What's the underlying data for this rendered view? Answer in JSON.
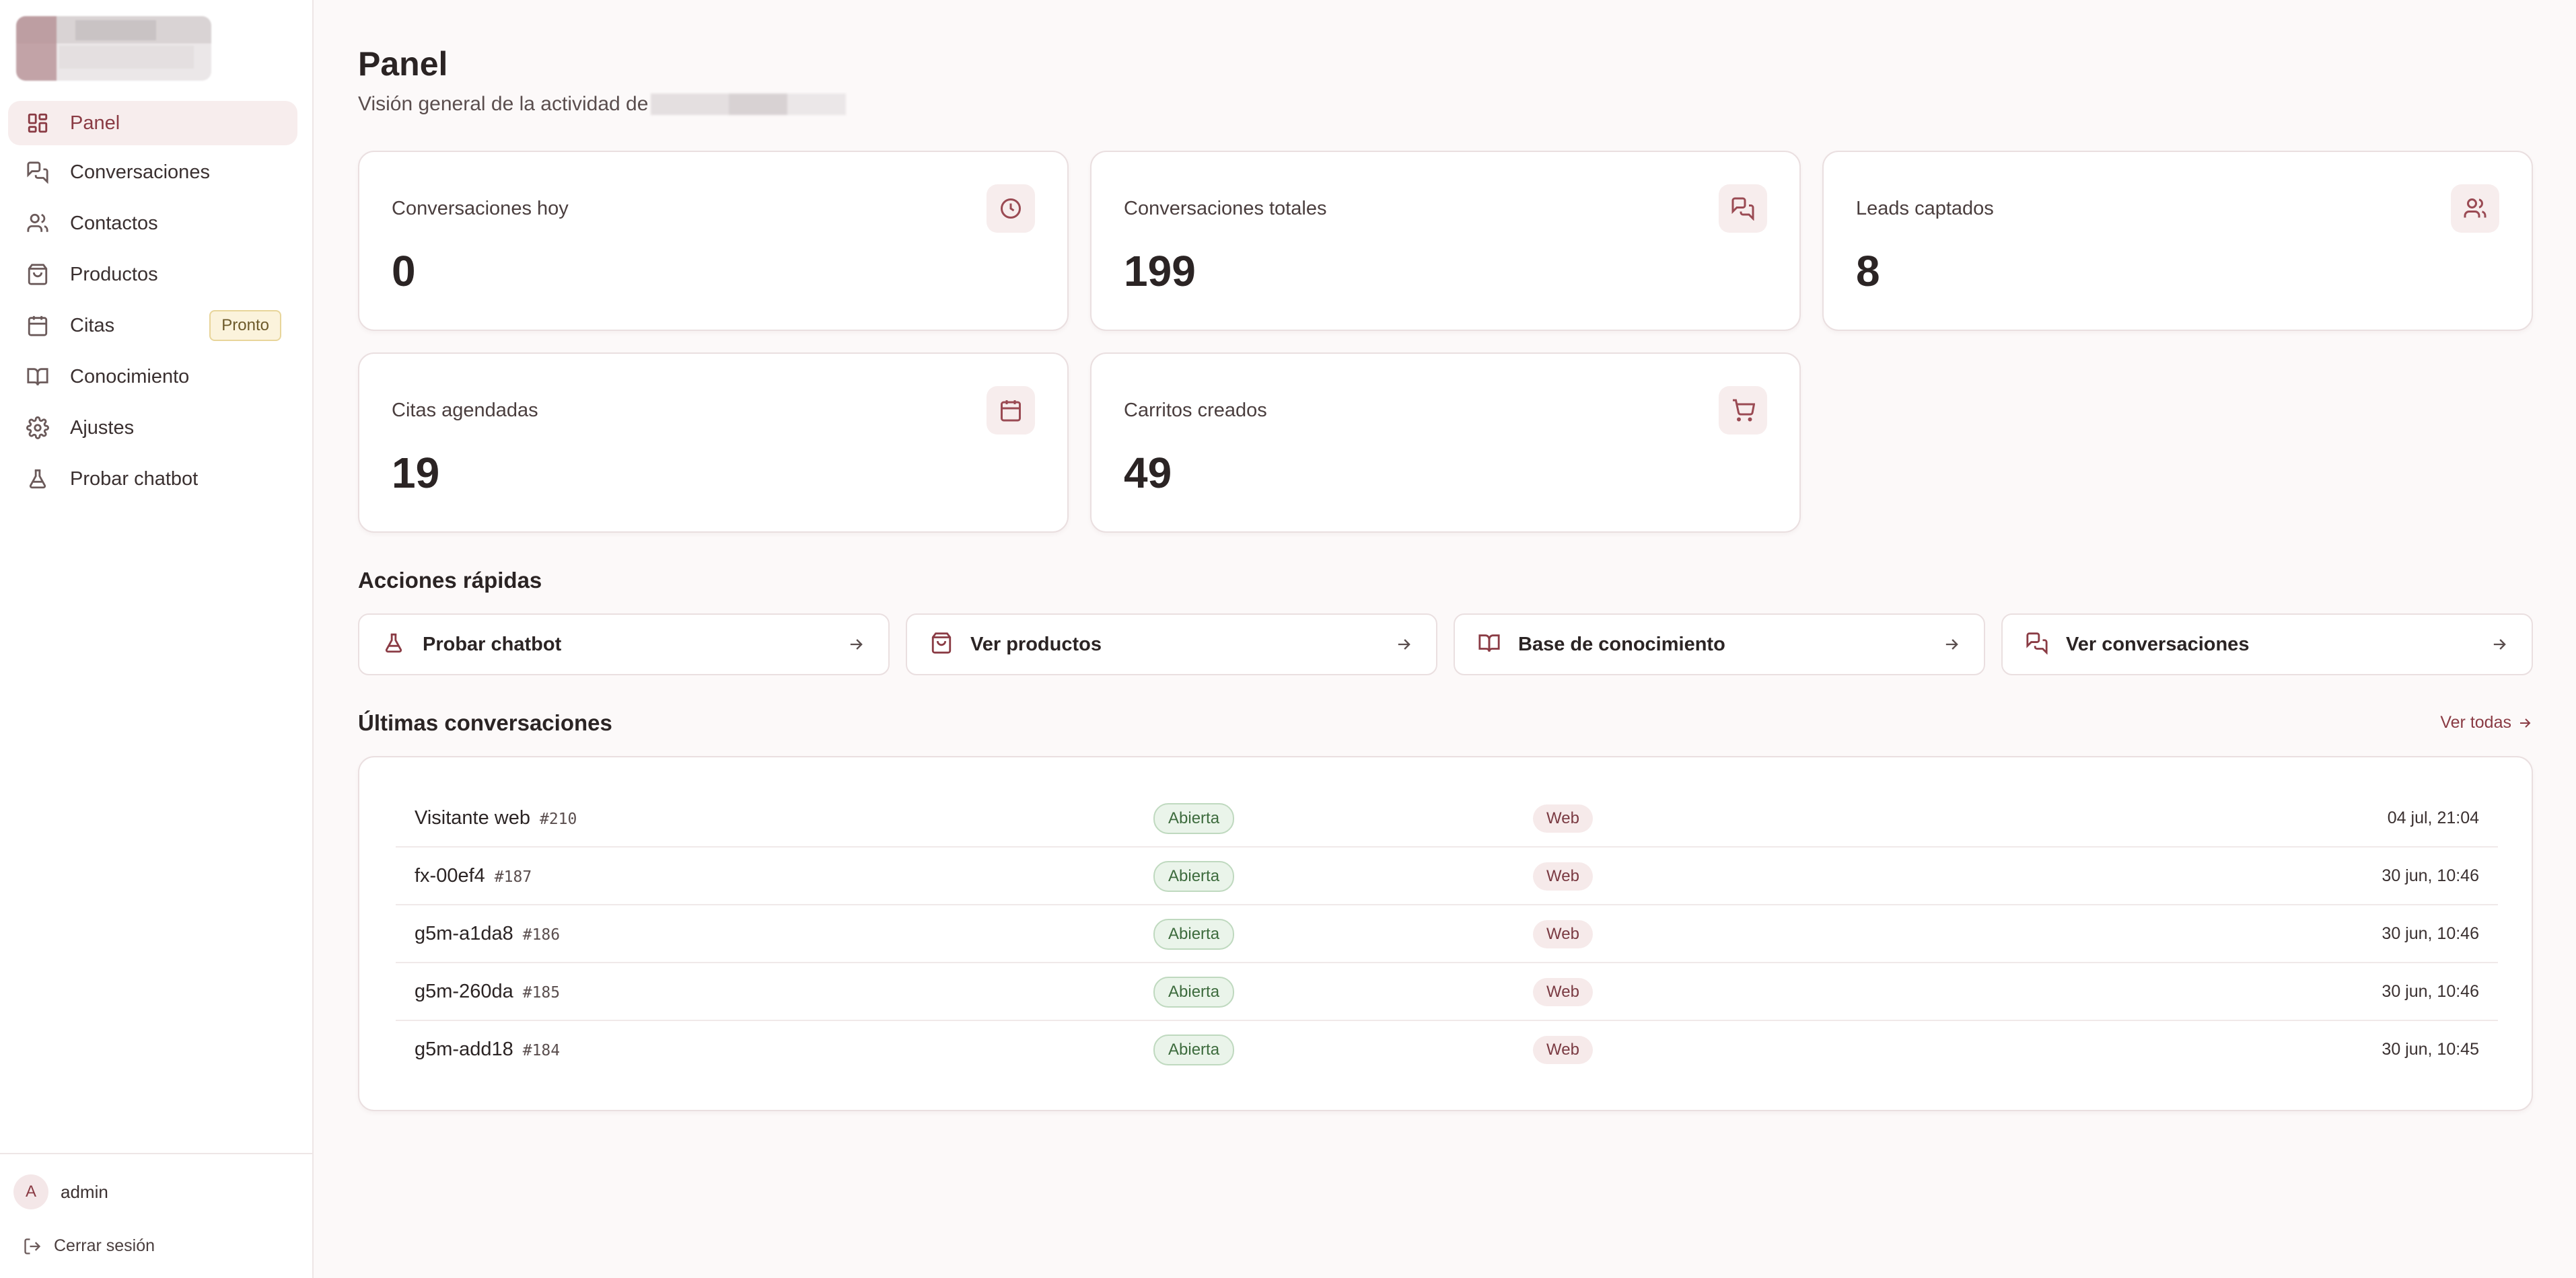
{
  "sidebar": {
    "items": [
      {
        "label": "Panel",
        "icon": "dashboard-icon"
      },
      {
        "label": "Conversaciones",
        "icon": "chat-icon"
      },
      {
        "label": "Contactos",
        "icon": "users-icon"
      },
      {
        "label": "Productos",
        "icon": "shopping-bag-icon"
      },
      {
        "label": "Citas",
        "icon": "calendar-icon",
        "badge": "Pronto"
      },
      {
        "label": "Conocimiento",
        "icon": "book-icon"
      },
      {
        "label": "Ajustes",
        "icon": "gear-icon"
      },
      {
        "label": "Probar chatbot",
        "icon": "flask-icon"
      }
    ],
    "user": {
      "initial": "A",
      "name": "admin"
    },
    "logout_label": "Cerrar sesión"
  },
  "header": {
    "title": "Panel",
    "subtitle": "Visión general de la actividad de"
  },
  "stats": [
    {
      "label": "Conversaciones hoy",
      "value": "0",
      "icon": "clock-icon"
    },
    {
      "label": "Conversaciones totales",
      "value": "199",
      "icon": "chat-icon"
    },
    {
      "label": "Leads captados",
      "value": "8",
      "icon": "users-icon"
    },
    {
      "label": "Citas agendadas",
      "value": "19",
      "icon": "calendar-icon"
    },
    {
      "label": "Carritos creados",
      "value": "49",
      "icon": "cart-icon"
    }
  ],
  "quick_actions": {
    "title": "Acciones rápidas",
    "items": [
      {
        "label": "Probar chatbot",
        "icon": "flask-icon"
      },
      {
        "label": "Ver productos",
        "icon": "shopping-bag-icon"
      },
      {
        "label": "Base de conocimiento",
        "icon": "book-icon"
      },
      {
        "label": "Ver conversaciones",
        "icon": "chat-icon"
      }
    ]
  },
  "recent": {
    "title": "Últimas conversaciones",
    "see_all": "Ver todas",
    "rows": [
      {
        "name": "Visitante web",
        "id": "#210",
        "status": "Abierta",
        "channel": "Web",
        "time": "04 jul, 21:04"
      },
      {
        "name": "fx-00ef4",
        "id": "#187",
        "status": "Abierta",
        "channel": "Web",
        "time": "30 jun, 10:46"
      },
      {
        "name": "g5m-a1da8",
        "id": "#186",
        "status": "Abierta",
        "channel": "Web",
        "time": "30 jun, 10:46"
      },
      {
        "name": "g5m-260da",
        "id": "#185",
        "status": "Abierta",
        "channel": "Web",
        "time": "30 jun, 10:46"
      },
      {
        "name": "g5m-add18",
        "id": "#184",
        "status": "Abierta",
        "channel": "Web",
        "time": "30 jun, 10:45"
      }
    ]
  },
  "colors": {
    "accent": "#8a3b44",
    "background": "#fcf9f9",
    "status_open": "#3d6b3d"
  }
}
